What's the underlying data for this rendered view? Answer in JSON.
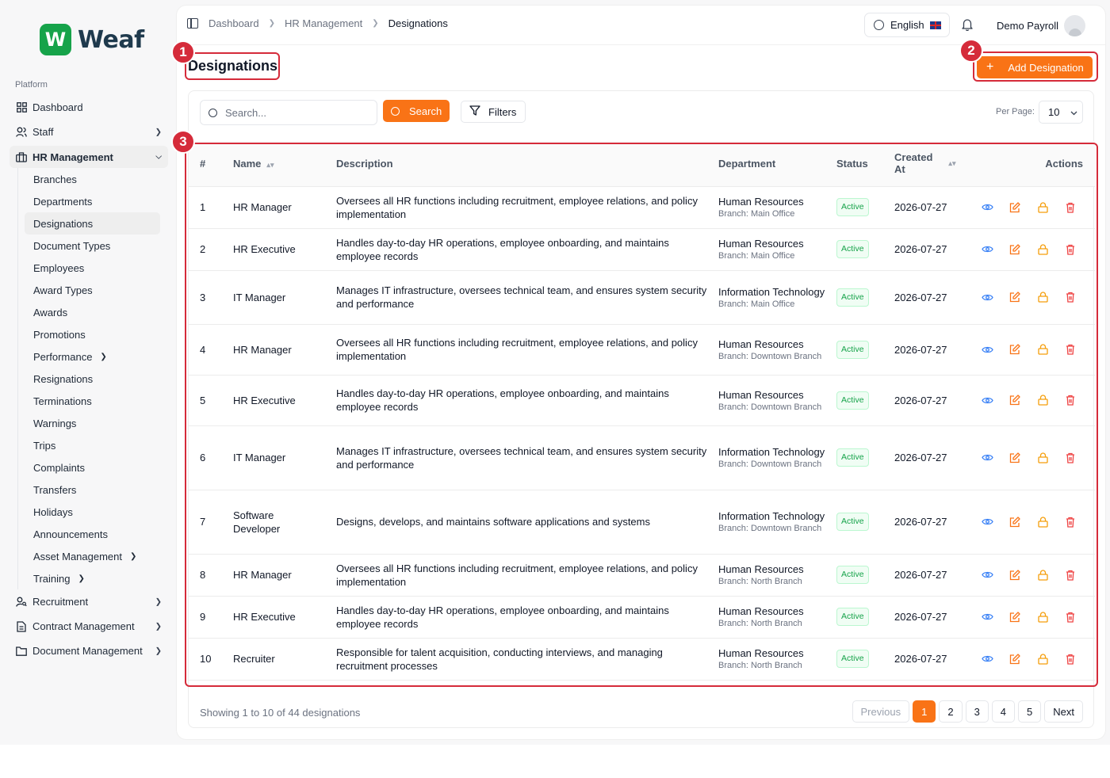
{
  "brand": {
    "logo_letter": "W",
    "name": "Weaf"
  },
  "sidebar": {
    "section_label": "Platform",
    "items": [
      {
        "label": "Dashboard",
        "icon": "grid-icon"
      },
      {
        "label": "Staff",
        "icon": "users-icon"
      },
      {
        "label": "HR Management",
        "icon": "briefcase-icon"
      }
    ],
    "hr_sub": [
      "Branches",
      "Departments",
      "Designations",
      "Document Types",
      "Employees",
      "Award Types",
      "Awards",
      "Promotions",
      "Performance",
      "Resignations",
      "Terminations",
      "Warnings",
      "Trips",
      "Complaints",
      "Transfers",
      "Holidays",
      "Announcements",
      "Asset Management",
      "Training"
    ],
    "bottom_items": [
      {
        "label": "Recruitment",
        "icon": "user-search-icon"
      },
      {
        "label": "Contract Management",
        "icon": "file-icon"
      },
      {
        "label": "Document Management",
        "icon": "folder-icon"
      }
    ]
  },
  "topbar": {
    "breadcrumbs": [
      "Dashboard",
      "HR Management",
      "Designations"
    ],
    "language": "English",
    "user_name": "Demo Payroll"
  },
  "page": {
    "title": "Designations",
    "add_button": "Add Designation"
  },
  "toolbar": {
    "search_placeholder": "Search...",
    "search_button": "Search",
    "filters_button": "Filters",
    "per_page_label": "Per Page:",
    "per_page_value": "10"
  },
  "table": {
    "headers": {
      "num": "#",
      "name": "Name",
      "description": "Description",
      "department": "Department",
      "status": "Status",
      "created_l1": "Created",
      "created_l2": "At",
      "actions": "Actions"
    },
    "rows": [
      {
        "num": "1",
        "name": "HR Manager",
        "description": "Oversees all HR functions including recruitment, employee relations, and policy implementation",
        "department": "Human Resources",
        "branch": "Branch: Main Office",
        "status": "Active",
        "created": "2026-07-27"
      },
      {
        "num": "2",
        "name": "HR Executive",
        "description": "Handles day-to-day HR operations, employee onboarding, and maintains employee records",
        "department": "Human Resources",
        "branch": "Branch: Main Office",
        "status": "Active",
        "created": "2026-07-27"
      },
      {
        "num": "3",
        "name": "IT Manager",
        "description": "Manages IT infrastructure, oversees technical team, and ensures system security and performance",
        "department": "Information Technology",
        "branch": "Branch: Main Office",
        "status": "Active",
        "created": "2026-07-27"
      },
      {
        "num": "4",
        "name": "HR Manager",
        "description": "Oversees all HR functions including recruitment, employee relations, and policy implementation",
        "department": "Human Resources",
        "branch": "Branch: Downtown Branch",
        "status": "Active",
        "created": "2026-07-27"
      },
      {
        "num": "5",
        "name": "HR Executive",
        "description": "Handles day-to-day HR operations, employee onboarding, and maintains employee records",
        "department": "Human Resources",
        "branch": "Branch: Downtown Branch",
        "status": "Active",
        "created": "2026-07-27"
      },
      {
        "num": "6",
        "name": "IT Manager",
        "description": "Manages IT infrastructure, oversees technical team, and ensures system security and performance",
        "department": "Information Technology",
        "branch": "Branch: Downtown Branch",
        "status": "Active",
        "created": "2026-07-27"
      },
      {
        "num": "7",
        "name": "Software Developer",
        "description": "Designs, develops, and maintains software applications and systems",
        "department": "Information Technology",
        "branch": "Branch: Downtown Branch",
        "status": "Active",
        "created": "2026-07-27"
      },
      {
        "num": "8",
        "name": "HR Manager",
        "description": "Oversees all HR functions including recruitment, employee relations, and policy implementation",
        "department": "Human Resources",
        "branch": "Branch: North Branch",
        "status": "Active",
        "created": "2026-07-27"
      },
      {
        "num": "9",
        "name": "HR Executive",
        "description": "Handles day-to-day HR operations, employee onboarding, and maintains employee records",
        "department": "Human Resources",
        "branch": "Branch: North Branch",
        "status": "Active",
        "created": "2026-07-27"
      },
      {
        "num": "10",
        "name": "Recruiter",
        "description": "Responsible for talent acquisition, conducting interviews, and managing recruitment processes",
        "department": "Human Resources",
        "branch": "Branch: North Branch",
        "status": "Active",
        "created": "2026-07-27"
      }
    ]
  },
  "footer": {
    "showing_prefix": "Showing ",
    "from": "1",
    "to_word": " to ",
    "to": "10",
    "of_word": " of ",
    "total": "44",
    "suffix": " designations",
    "previous": "Previous",
    "pages": [
      "1",
      "2",
      "3",
      "4",
      "5"
    ],
    "next": "Next"
  },
  "annotations": [
    "1",
    "2",
    "3"
  ],
  "colors": {
    "accent": "#f97316",
    "annotation": "#d52b3a",
    "success": "#16a34a",
    "view": "#3b82f6",
    "lock": "#f59e0b",
    "delete": "#ef4444",
    "edit": "#f97316"
  }
}
